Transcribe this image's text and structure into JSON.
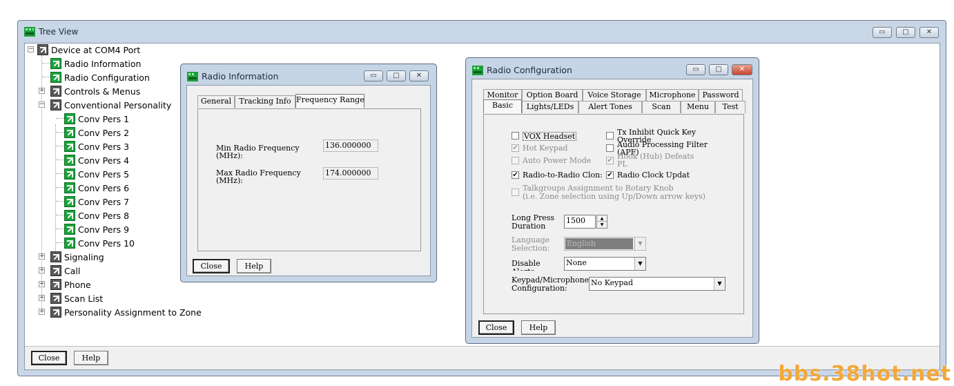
{
  "tree_window": {
    "title": "Tree View",
    "minimize": "▭",
    "maximize": "□",
    "close": "✕",
    "footer": {
      "close_label": "Close",
      "help_label": "Help"
    }
  },
  "tree": {
    "root": "Device at COM4 Port",
    "radio_information": "Radio Information",
    "radio_configuration": "Radio Configuration",
    "controls_menus": "Controls & Menus",
    "conventional_personality": "Conventional Personality",
    "conv_pers": [
      "Conv Pers 1",
      "Conv Pers 2",
      "Conv Pers 3",
      "Conv Pers 4",
      "Conv Pers 5",
      "Conv Pers 6",
      "Conv Pers 7",
      "Conv Pers 8",
      "Conv Pers 9",
      "Conv Pers 10"
    ],
    "signaling": "Signaling",
    "call": "Call",
    "phone": "Phone",
    "scan_list": "Scan List",
    "personality_assignment": "Personality Assignment to Zone"
  },
  "radio_info": {
    "title": "Radio Information",
    "tabs": [
      "General",
      "Tracking Info",
      "Frequency Range"
    ],
    "min_label_1": "Min Radio Frequency",
    "min_label_2": "(MHz):",
    "min_value": "136.000000",
    "max_label_1": "Max Radio Frequency",
    "max_label_2": "(MHz):",
    "max_value": "174.000000",
    "close_label": "Close",
    "help_label": "Help"
  },
  "radio_config": {
    "title": "Radio Configuration",
    "tabs_row1": [
      "Monitor",
      "Option Board",
      "Voice Storage",
      "Microphone",
      "Password"
    ],
    "tabs_row2": [
      "Basic",
      "Lights/LEDs",
      "Alert Tones",
      "Scan",
      "Menu",
      "Test"
    ],
    "vox_headset": "VOX  Headset",
    "tx_inhibit_1": "Tx Inhibit Quick Key",
    "tx_inhibit_2": "Override",
    "hot_keypad": "Hot Keypad",
    "audio_proc_1": "Audio Processing Filter",
    "audio_proc_2": "(APF)",
    "auto_power": "Auto Power Mode",
    "hook_1": "Hook (Hub) Defeats",
    "hook_2": "PL",
    "radio_clone": "Radio-to-Radio Clon:",
    "radio_clock": "Radio Clock Updat",
    "talkgroups_1": "Talkgroups Assignment to Rotary Knob",
    "talkgroups_2": "(i.e. Zone selection using Up/Down arrow keys)",
    "long_press_1": "Long Press",
    "long_press_2": "Duration",
    "long_press_value": "1500",
    "language_1": "Language",
    "language_2": "Selection:",
    "language_value": "English",
    "disable_1": "Disable",
    "disable_2": "Alerts",
    "disable_value": "None",
    "keypad_1": "Keypad/Microphone",
    "keypad_2": "Configuration:",
    "keypad_value": "No Keypad",
    "close_label": "Close",
    "help_label": "Help"
  },
  "watermark": "bbs.38hot.net"
}
